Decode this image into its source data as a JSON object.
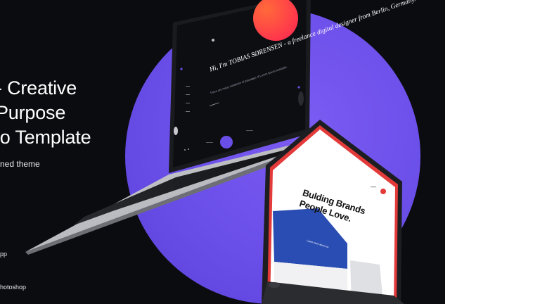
{
  "headline": {
    "line1": "- Creative",
    "line2": "Purpose",
    "line3": "io Template"
  },
  "subline": "ned theme",
  "features": [
    "pp",
    "hotoshop"
  ],
  "mockup_dark": {
    "title": "Hi, I'm TOBIAS SØRENSEN - a freelance digital designer from Berlin, Germany.",
    "body": "There are many variations of passages of Lorem Ipsum available."
  },
  "mockup_light": {
    "headline_line1": "Bulding Brands",
    "headline_line2": "People Love.",
    "button": "Learn more about us"
  },
  "colors": {
    "background": "#0b0c10",
    "circle": "#6a4ee8",
    "accent_red": "#ff3b3b",
    "accent_blue": "#2a4db3"
  }
}
